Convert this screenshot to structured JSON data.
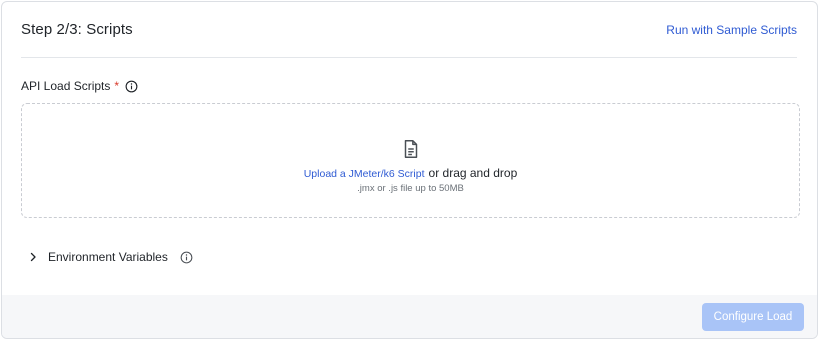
{
  "header": {
    "title": "Step 2/3: Scripts",
    "sample_link": "Run with Sample Scripts"
  },
  "scripts_field": {
    "label": "API Load Scripts",
    "required_marker": "*",
    "info_icon": "info-circle-icon"
  },
  "dropzone": {
    "icon": "document-icon",
    "upload_link": "Upload a JMeter/k6 Script",
    "upload_rest": "or drag and drop",
    "hint": ".jmx or .js file up to 50MB"
  },
  "env_vars": {
    "icon": "chevron-right-icon",
    "label": "Environment Variables",
    "info_icon": "info-circle-icon"
  },
  "footer": {
    "primary_label": "Configure Load",
    "primary_state": "disabled"
  },
  "colors": {
    "link": "#2f5bd3",
    "required": "#d93a2b",
    "primary_disabled": "#a9c4f7",
    "footer_bg": "#f6f7f9"
  }
}
